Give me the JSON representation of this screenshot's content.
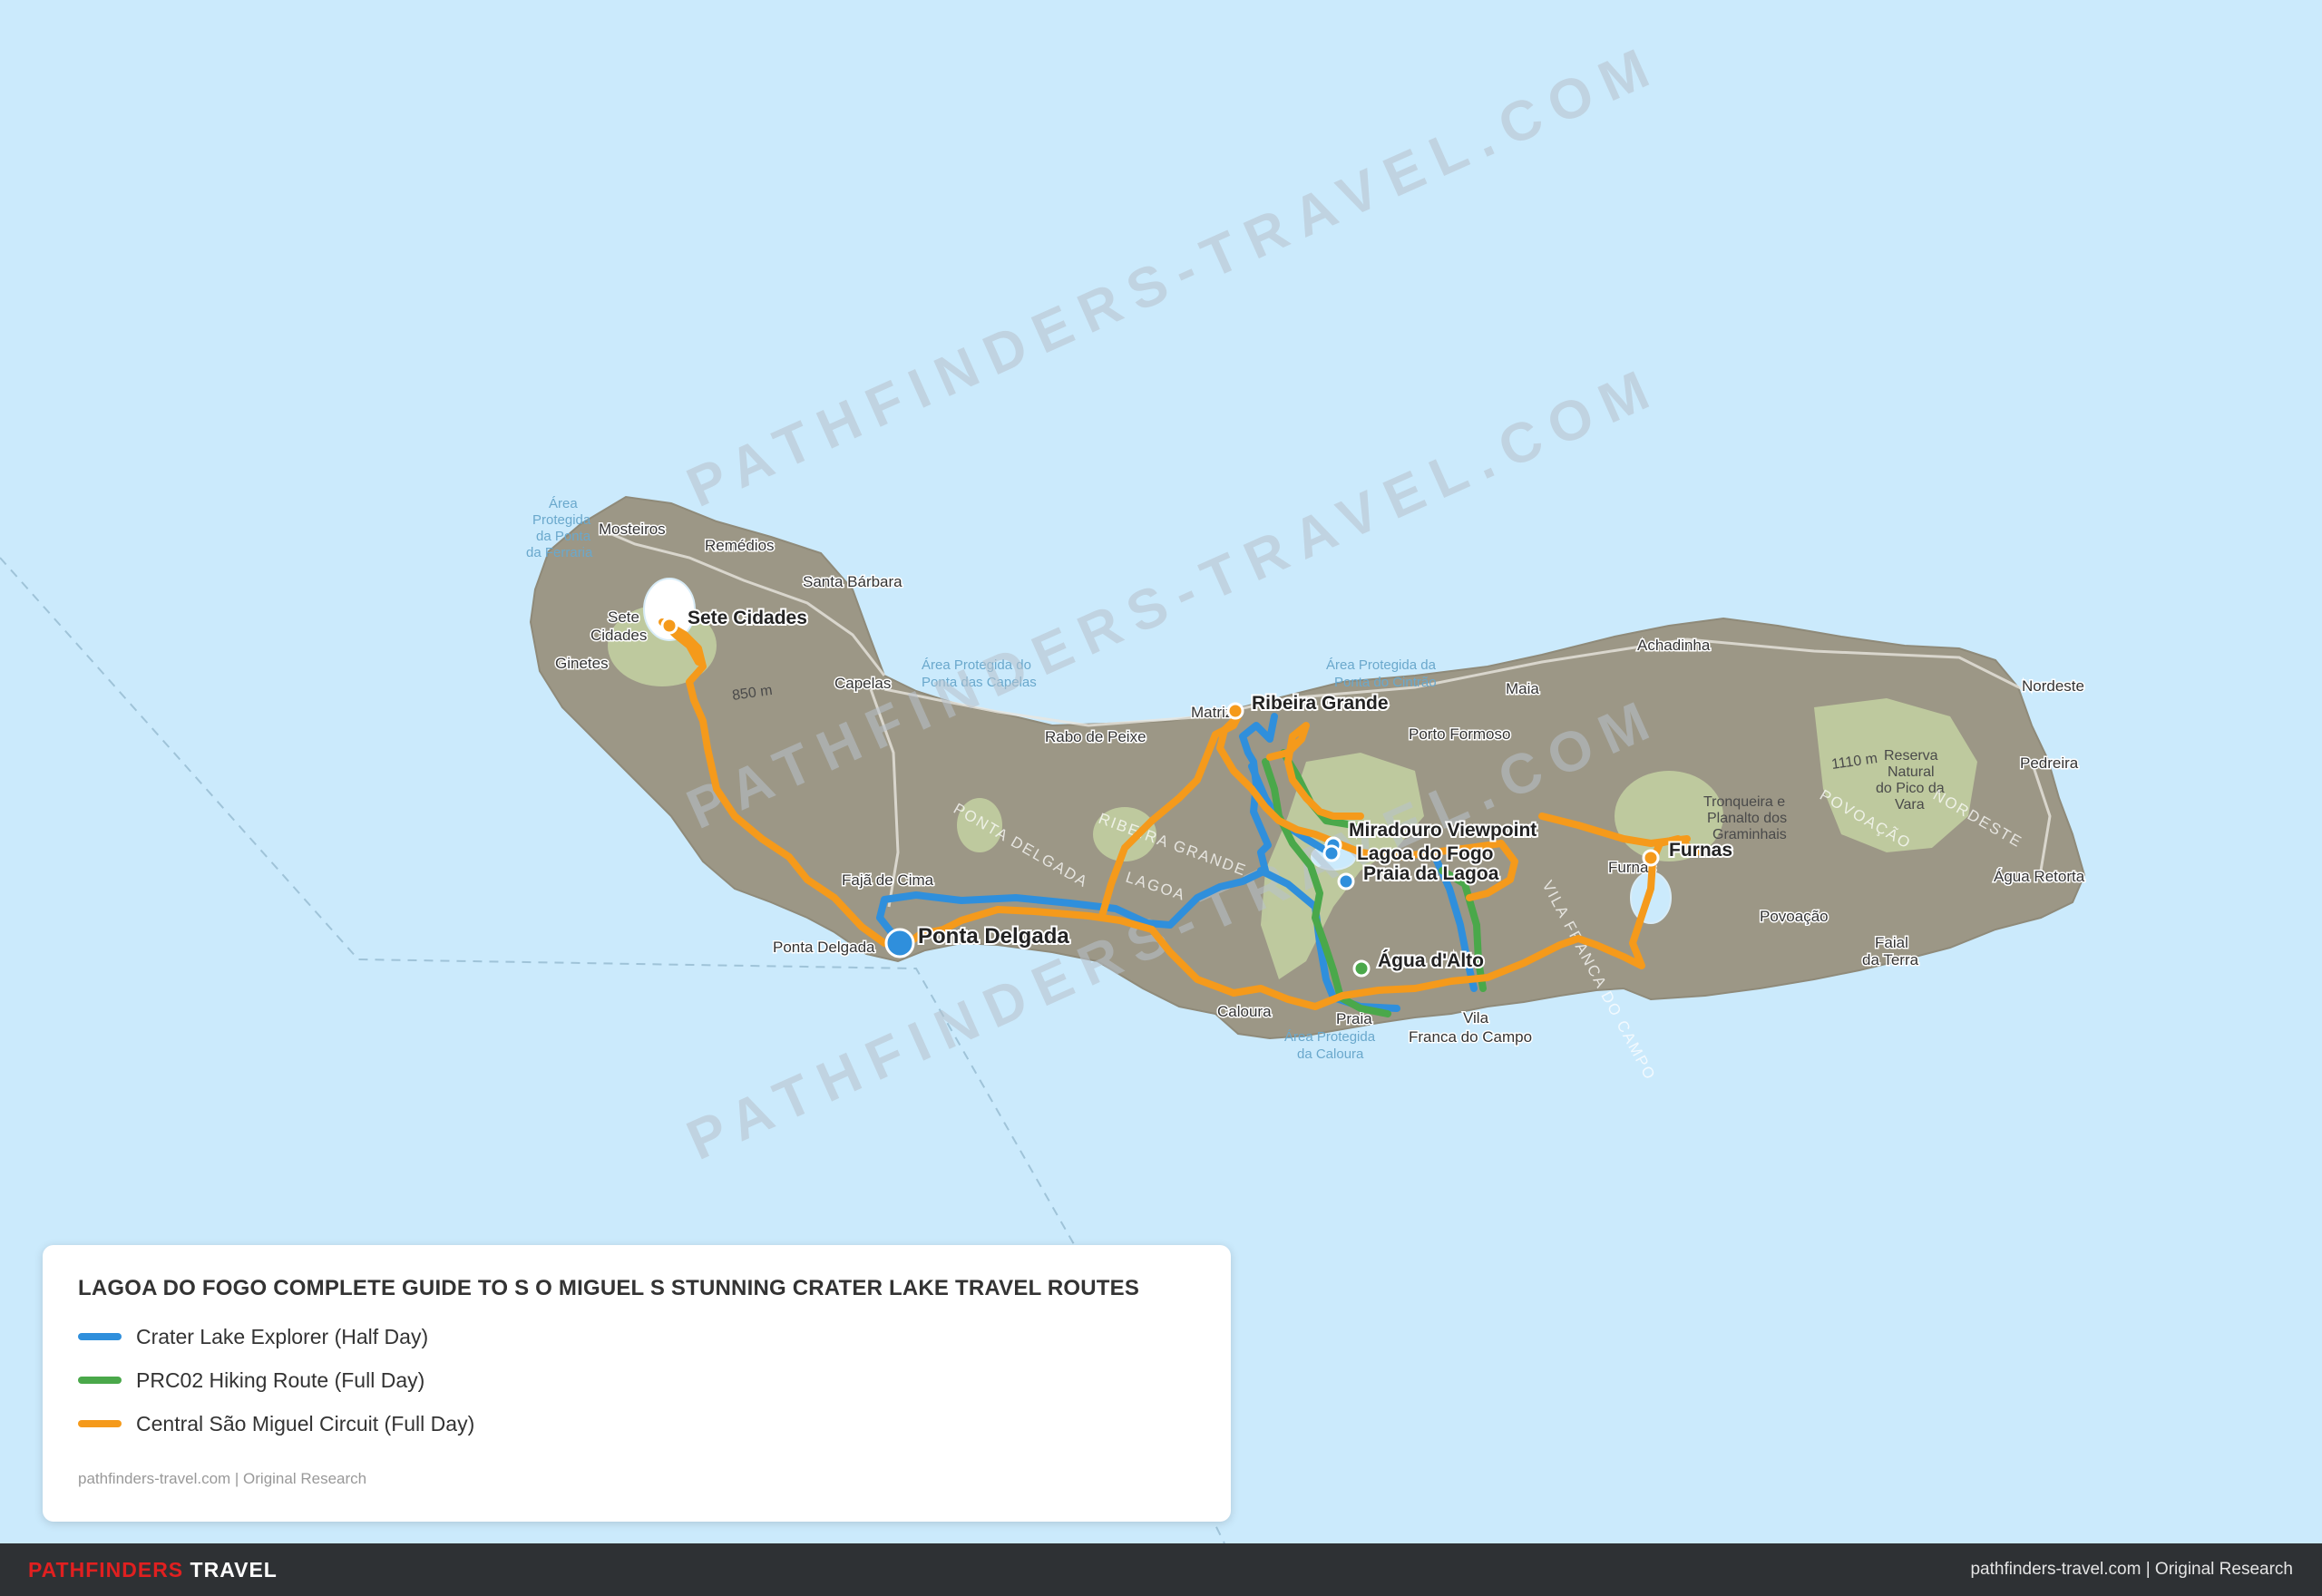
{
  "map": {
    "colors": {
      "sea": "#cbeafc",
      "land": "#9c9786",
      "forest": "#c9d9a6",
      "route_blue": "#2f8fdc",
      "route_green": "#4aa84a",
      "route_orange": "#f59a1b"
    },
    "watermark": "PATHFINDERS-TRAVEL.COM",
    "places": [
      {
        "name": "Sete Cidades",
        "role": "stop",
        "route": "orange"
      },
      {
        "name": "Ribeira Grande",
        "role": "stop",
        "route": "orange"
      },
      {
        "name": "Miradouro Viewpoint",
        "role": "stop",
        "route": "blue"
      },
      {
        "name": "Lagoa do Fogo",
        "role": "stop",
        "route": "blue"
      },
      {
        "name": "Praia da Lagoa",
        "role": "stop",
        "route": "blue"
      },
      {
        "name": "Furnas",
        "role": "stop",
        "route": "orange"
      },
      {
        "name": "Ponta Delgada",
        "role": "start",
        "route": "blue"
      },
      {
        "name": "Água d'Alto",
        "role": "stop",
        "route": "green"
      }
    ],
    "basemap_labels": [
      {
        "text": "Mosteiros"
      },
      {
        "text": "Remédios"
      },
      {
        "text": "Santa Bárbara"
      },
      {
        "text": "Sete"
      },
      {
        "text": "Cidades"
      },
      {
        "text": "Ginetes"
      },
      {
        "text": "Capelas"
      },
      {
        "text": "Rabo de Peixe"
      },
      {
        "text": "Matriz"
      },
      {
        "text": "Maia"
      },
      {
        "text": "Achadinha"
      },
      {
        "text": "Nordeste"
      },
      {
        "text": "Pedreira"
      },
      {
        "text": "Porto Formoso"
      },
      {
        "text": "Fajã de Cima"
      },
      {
        "text": "Ponta Delgada"
      },
      {
        "text": "Caloura"
      },
      {
        "text": "Praia"
      },
      {
        "text": "Vila"
      },
      {
        "text": "Franca do Campo"
      },
      {
        "text": "Furnas"
      },
      {
        "text": "Povoação"
      },
      {
        "text": "Faial"
      },
      {
        "text": "da Terra"
      },
      {
        "text": "Água Retorta"
      },
      {
        "text": "850 m"
      },
      {
        "text": "1110 m"
      },
      {
        "text": "Área"
      },
      {
        "text": "Protegida"
      },
      {
        "text": "da Ponta"
      },
      {
        "text": "da Ferraria"
      },
      {
        "text": "Área Protegida do"
      },
      {
        "text": "Ponta das Capelas"
      },
      {
        "text": "Área Protegida da"
      },
      {
        "text": "Ponta do Cintrão"
      },
      {
        "text": "Área Protegida"
      },
      {
        "text": "da Caloura"
      },
      {
        "text": "Reserva"
      },
      {
        "text": "Natural"
      },
      {
        "text": "do Pico da"
      },
      {
        "text": "Vara"
      },
      {
        "text": "Tronqueira e"
      },
      {
        "text": "Planalto dos"
      },
      {
        "text": "Graminhais"
      },
      {
        "text": "PONTA DELGADA"
      },
      {
        "text": "RIBEIRA GRANDE"
      },
      {
        "text": "LAGOA"
      },
      {
        "text": "VILA FRANCA DO CAMPO"
      },
      {
        "text": "POVOAÇÃO"
      },
      {
        "text": "NORDESTE"
      }
    ]
  },
  "legend": {
    "title": "LAGOA DO FOGO COMPLETE GUIDE TO S O MIGUEL S STUNNING CRATER LAKE TRAVEL ROUTES",
    "routes": [
      {
        "label": "Crater Lake Explorer (Half Day)",
        "color": "#2f8fdc"
      },
      {
        "label": "PRC02 Hiking Route (Full Day)",
        "color": "#4aa84a"
      },
      {
        "label": "Central São Miguel Circuit (Full Day)",
        "color": "#f59a1b"
      }
    ],
    "source": "pathfinders-travel.com | Original Research"
  },
  "footer": {
    "brand_red": "PATHFINDERS",
    "brand_white": "TRAVEL",
    "right": "pathfinders-travel.com  |  Original Research"
  }
}
